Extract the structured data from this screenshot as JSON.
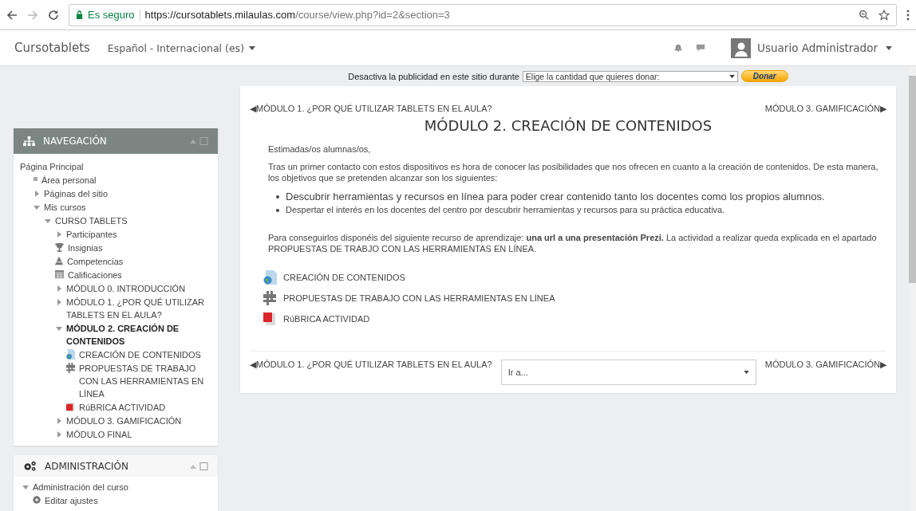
{
  "browser": {
    "security_label": "Es seguro",
    "url_host": "https://cursotablets.milaulas.com",
    "url_path": "/course/view.php?id=2&section=3"
  },
  "navbar": {
    "brand": "Cursotablets",
    "language": "Español - Internacional (es)",
    "user": "Usuario Administrador"
  },
  "ad_bar": {
    "text": "Desactiva la publicidad en este sitio durante",
    "select": "Elige la cantidad que quieres donar:",
    "button": "Donar"
  },
  "navigation_block": {
    "title": "NAVEGACIÓN",
    "items": [
      {
        "label": "Página Principal",
        "kind": "plain",
        "current": false,
        "children": [
          {
            "label": "Área personal",
            "kind": "leaf",
            "current": false
          },
          {
            "label": "Páginas del sitio",
            "kind": "branch",
            "expanded": false,
            "current": false
          },
          {
            "label": "Mis cursos",
            "kind": "branch",
            "expanded": true,
            "current": false,
            "children": [
              {
                "label": "CURSO TABLETS",
                "kind": "branch",
                "expanded": true,
                "current": false,
                "children": [
                  {
                    "label": "Participantes",
                    "kind": "branch",
                    "expanded": false,
                    "current": false
                  },
                  {
                    "label": "Insignias",
                    "kind": "trophy",
                    "current": false
                  },
                  {
                    "label": "Competencias",
                    "kind": "competency",
                    "current": false
                  },
                  {
                    "label": "Calificaciones",
                    "kind": "grades",
                    "current": false
                  },
                  {
                    "label": "MÓDULO 0. INTRODUCCIÓN",
                    "kind": "branch",
                    "expanded": false,
                    "current": false
                  },
                  {
                    "label": "MÓDULO 1. ¿POR QUÉ UTILIZAR TABLETS EN EL AULA?",
                    "kind": "branch",
                    "expanded": false,
                    "current": false
                  },
                  {
                    "label": "MÓDULO 2. CREACIÓN DE CONTENIDOS",
                    "kind": "branch",
                    "expanded": true,
                    "current": true,
                    "children": [
                      {
                        "label": "CREACIÓN DE CONTENIDOS",
                        "kind": "url",
                        "current": false
                      },
                      {
                        "label": "PROPUESTAS DE TRABAJO CON LAS HERRAMIENTAS EN LÍNEA",
                        "kind": "page",
                        "current": false
                      },
                      {
                        "label": "RúBRICA ACTIVIDAD",
                        "kind": "pdf",
                        "current": false
                      }
                    ]
                  },
                  {
                    "label": "MÓDULO 3. GAMIFICACIÓN",
                    "kind": "branch",
                    "expanded": false,
                    "current": false
                  },
                  {
                    "label": "MÓDULO FINAL",
                    "kind": "branch",
                    "expanded": false,
                    "current": false
                  }
                ]
              }
            ]
          }
        ]
      }
    ]
  },
  "administration_block": {
    "title": "ADMINISTRACIÓN",
    "items": [
      {
        "label": "Administración del curso",
        "kind": "branch",
        "expanded": true,
        "current": false,
        "children": [
          {
            "label": "Editar ajustes",
            "kind": "gear",
            "current": false
          }
        ]
      }
    ]
  },
  "section": {
    "top_prev_link": "MÓDULO 1. ¿POR QUÉ UTILIZAR TABLETS EN EL AULA?",
    "top_next_link": "MÓDULO 3. GAMIFICACIÓN",
    "top_prev_arrow": "◀",
    "top_next_arrow": "▶",
    "title": "MÓDULO 2. CREACIÓN DE CONTENIDOS",
    "greeting": "Estimadas/os alumnas/os,",
    "intro": "Tras un primer contacto con estos dispositivos es hora de conocer las posibilidades que nos ofrecen en cuanto a la creación de contenidos. De esta manera, los objetivos que se pretenden alcanzar son los siguientes:",
    "objectives": [
      {
        "text": "Descubrir herramientas y recursos en línea para poder crear contenido tanto los docentes como los propios alumnos.",
        "kind": "large"
      },
      {
        "text": "Despertar el interés en los docentes del centro por descubrir herramientas y recursos para su práctica educativa.",
        "kind": "normal"
      }
    ],
    "resources_text": "Para conseguirlos disponéis del siguiente recurso de aprendizaje: **una url a una presentación Prezi.**  La actividad a realizar queda explicada en el apartado PROPUESTAS DE TRABJO CON LAS HERRAMIENTAS EN LÍNEA.",
    "activities": [
      {
        "label": "CREACIÓN DE CONTENIDOS",
        "kind": "url"
      },
      {
        "label": "PROPUESTAS DE TRABAJO CON LAS HERRAMIENTAS EN LÍNEA",
        "kind": "page"
      },
      {
        "label": "RúBRICA ACTIVIDAD",
        "kind": "pdf"
      }
    ],
    "bottom_prev_link": "MÓDULO 1. ¿POR QUÉ UTILIZAR TABLETS EN EL AULA?",
    "bottom_next_link": "MÓDULO 3. GAMIFICACIÓN",
    "bottom_prev_arrow": "◀",
    "bottom_next_arrow": "▶",
    "jump_placeholder": "Ir a..."
  }
}
